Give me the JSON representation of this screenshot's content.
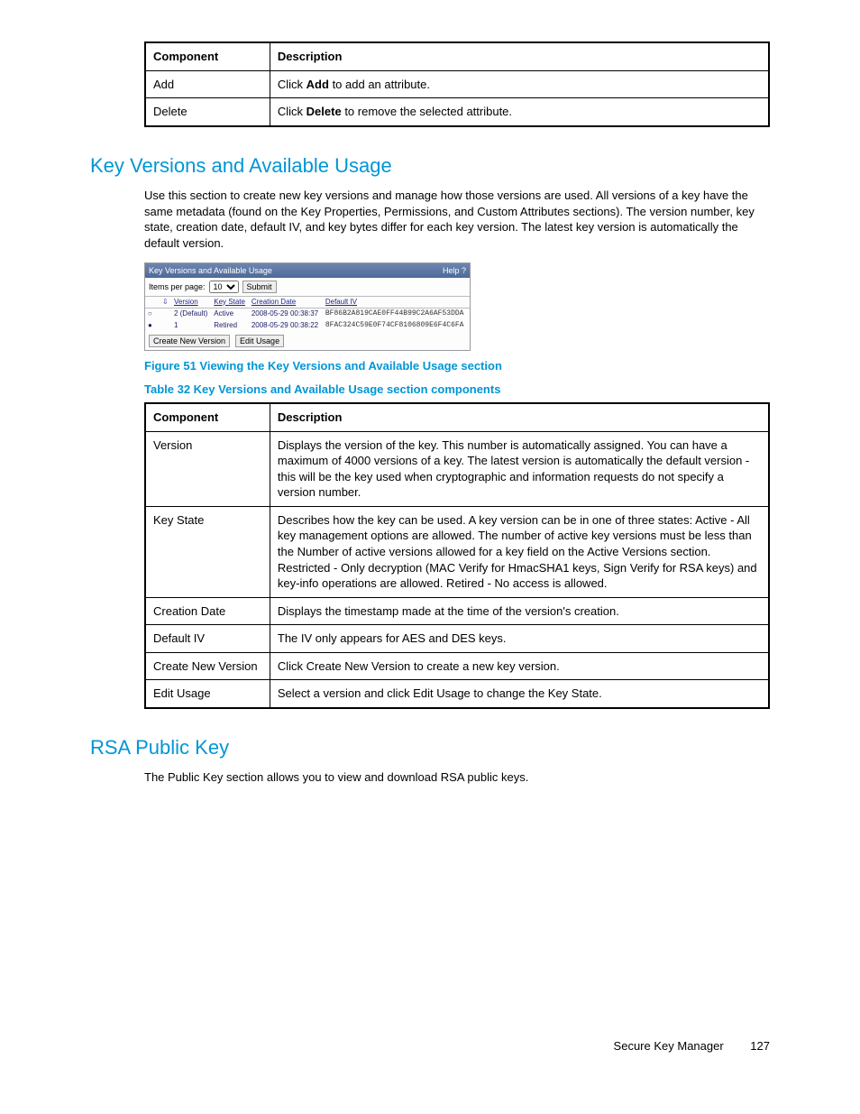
{
  "table1": {
    "headers": [
      "Component",
      "Description"
    ],
    "rows": [
      {
        "component": "Add",
        "pre": "Click ",
        "bold": "Add",
        "post": " to add an attribute."
      },
      {
        "component": "Delete",
        "pre": "Click ",
        "bold": "Delete",
        "post": " to remove the selected attribute."
      }
    ]
  },
  "section1": {
    "title": "Key Versions and Available Usage",
    "body": "Use this section to create new key versions and manage how those versions are used. All versions of a key have the same metadata (found on the Key Properties, Permissions, and Custom Attributes sections). The version number, key state, creation date, default IV, and key bytes differ for each key version. The latest key version is automatically the default version."
  },
  "panel": {
    "title": "Key Versions and Available Usage",
    "help": "Help",
    "items_label": "Items per page:",
    "items_value": "10",
    "submit": "Submit",
    "headers": {
      "version": "Version",
      "keystate": "Key State",
      "creation": "Creation Date",
      "defaultiv": "Default IV"
    },
    "arrow": "⇩",
    "rows": [
      {
        "sel": "○",
        "version": "2 (Default)",
        "state": "Active",
        "date": "2008-05-29 00:38:37",
        "iv": "BF86B2A819CAE0FF44B99C2A6AF53DDA"
      },
      {
        "sel": "●",
        "version": "1",
        "state": "Retired",
        "date": "2008-05-29 00:38:22",
        "iv": "8FAC324C59E0F74CF8106809E6F4C6FA"
      }
    ],
    "create": "Create New Version",
    "edit": "Edit Usage"
  },
  "fig_caption": "Figure 51 Viewing the Key Versions and Available Usage section",
  "tbl_caption": "Table 32 Key Versions and Available Usage section components",
  "table2": {
    "headers": [
      "Component",
      "Description"
    ],
    "rows": [
      {
        "c": "Version",
        "d": "Displays the version of the key. This number is automatically assigned. You can have a maximum of 4000 versions of a key. The latest version is automatically the default version - this will be the key used when cryptographic and information requests do not specify a version number."
      },
      {
        "c": "Key State",
        "d": "Describes how the key can be used. A key version can be in one of three states: Active - All key management options are allowed. The number of active key versions must be less than the Number of active versions allowed for a key field on the Active Versions section. Restricted - Only decryption (MAC Verify for HmacSHA1 keys, Sign Verify for RSA keys) and key-info operations are allowed. Retired - No access is allowed."
      },
      {
        "c": "Creation Date",
        "d": "Displays the timestamp made at the time of the version's creation."
      },
      {
        "c": "Default IV",
        "d": "The IV only appears for AES and DES keys."
      },
      {
        "c": "Create New Version",
        "d": "Click Create New Version to create a new key version."
      },
      {
        "c": "Edit Usage",
        "d": "Select a version and click Edit Usage to change the Key State."
      }
    ]
  },
  "section2": {
    "title": "RSA Public Key",
    "body": "The Public Key section allows you to view and download RSA public keys."
  },
  "footer": {
    "doc": "Secure Key Manager",
    "page": "127"
  }
}
